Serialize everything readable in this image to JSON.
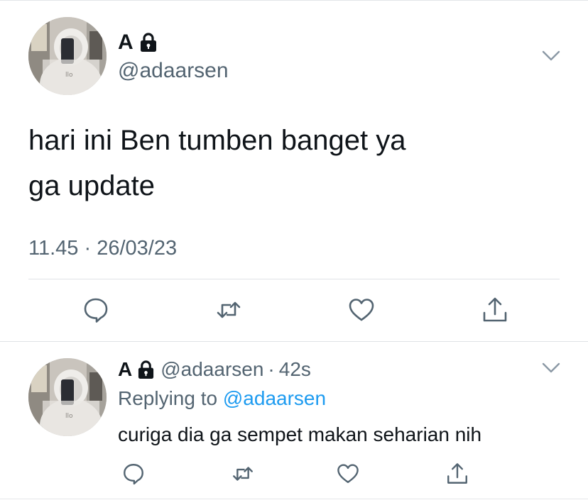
{
  "colors": {
    "text_primary": "#0f1419",
    "text_secondary": "#536471",
    "mention": "#1d9bf0",
    "divider": "#dfe3e6"
  },
  "main_tweet": {
    "display_name": "A",
    "handle": "@adaarsen",
    "text_lines": [
      "hari ini Ben tumben banget ya",
      "ga update"
    ],
    "timestamp": "11.45 · 26/03/23",
    "icons": {
      "avatar": "avatar-photo",
      "lock": "lock-icon",
      "more": "chevron-down-icon",
      "reply": "reply-bubble-icon",
      "retweet": "retweet-icon",
      "like": "heart-icon",
      "share": "share-upload-icon"
    }
  },
  "reply_tweet": {
    "display_name": "A",
    "handle": "@adaarsen",
    "separator": "·",
    "time_ago": "42s",
    "replying_label": "Replying to",
    "replying_handle": "@adaarsen",
    "text": "curiga dia ga sempet makan seharian nih",
    "icons": {
      "avatar": "avatar-photo",
      "lock": "lock-icon",
      "more": "chevron-down-icon",
      "reply": "reply-bubble-icon",
      "retweet": "retweet-icon",
      "like": "heart-icon",
      "share": "share-upload-icon"
    }
  }
}
